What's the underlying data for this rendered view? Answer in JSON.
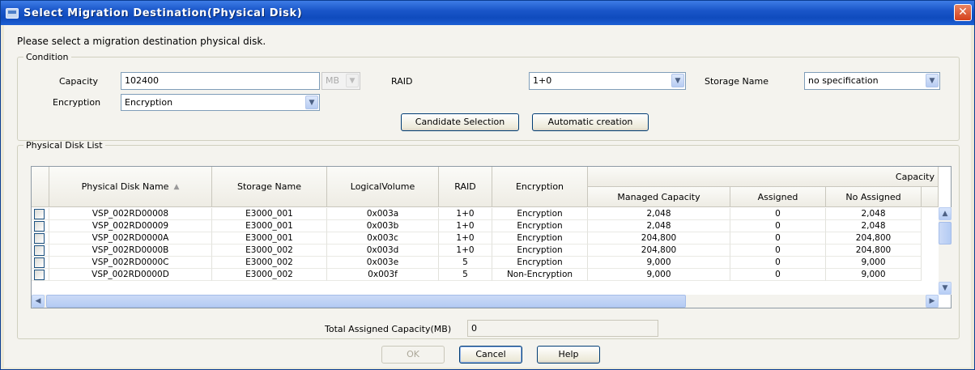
{
  "window": {
    "title": "Select Migration Destination(Physical Disk)",
    "close_glyph": "✕"
  },
  "instruction": "Please select a migration destination physical disk.",
  "condition": {
    "legend": "Condition",
    "capacity_label": "Capacity",
    "capacity_value": "102400",
    "unit_value": "MB",
    "raid_label": "RAID",
    "raid_value": "1+0",
    "storage_name_label": "Storage Name",
    "storage_name_value": "no specification",
    "encryption_label": "Encryption",
    "encryption_value": "Encryption",
    "candidate_selection_label": "Candidate Selection",
    "automatic_creation_label": "Automatic creation"
  },
  "disk_list": {
    "legend": "Physical Disk List",
    "group_header": "Capacity",
    "columns": {
      "physical_disk_name": "Physical Disk Name",
      "storage_name": "Storage Name",
      "logical_volume": "LogicalVolume",
      "raid": "RAID",
      "encryption": "Encryption",
      "managed_capacity": "Managed Capacity",
      "assigned": "Assigned",
      "no_assigned": "No Assigned"
    },
    "rows": [
      {
        "name": "VSP_002RD00008",
        "storage": "E3000_001",
        "volume": "0x003a",
        "raid": "1+0",
        "encryption": "Encryption",
        "managed": "2,048",
        "assigned": "0",
        "no_assigned": "2,048"
      },
      {
        "name": "VSP_002RD00009",
        "storage": "E3000_001",
        "volume": "0x003b",
        "raid": "1+0",
        "encryption": "Encryption",
        "managed": "2,048",
        "assigned": "0",
        "no_assigned": "2,048"
      },
      {
        "name": "VSP_002RD0000A",
        "storage": "E3000_001",
        "volume": "0x003c",
        "raid": "1+0",
        "encryption": "Encryption",
        "managed": "204,800",
        "assigned": "0",
        "no_assigned": "204,800"
      },
      {
        "name": "VSP_002RD0000B",
        "storage": "E3000_002",
        "volume": "0x003d",
        "raid": "1+0",
        "encryption": "Encryption",
        "managed": "204,800",
        "assigned": "0",
        "no_assigned": "204,800"
      },
      {
        "name": "VSP_002RD0000C",
        "storage": "E3000_002",
        "volume": "0x003e",
        "raid": "5",
        "encryption": "Encryption",
        "managed": "9,000",
        "assigned": "0",
        "no_assigned": "9,000"
      },
      {
        "name": "VSP_002RD0000D",
        "storage": "E3000_002",
        "volume": "0x003f",
        "raid": "5",
        "encryption": "Non-Encryption",
        "managed": "9,000",
        "assigned": "0",
        "no_assigned": "9,000"
      }
    ]
  },
  "total": {
    "label": "Total Assigned Capacity(MB)",
    "value": "0"
  },
  "buttons": {
    "ok": "OK",
    "cancel": "Cancel",
    "help": "Help"
  },
  "icons": {
    "window": "window-icon",
    "close": "close-icon",
    "dropdown": "chevron-down-icon",
    "sort": "sort-ascending-icon",
    "scroll_up": "arrow-up-icon",
    "scroll_down": "arrow-down-icon",
    "scroll_left": "arrow-left-icon",
    "scroll_right": "arrow-right-icon"
  },
  "colors": {
    "titlebar": "#0f4bbd",
    "close_button": "#d4401b",
    "dialog_background": "#f4f3ee"
  }
}
